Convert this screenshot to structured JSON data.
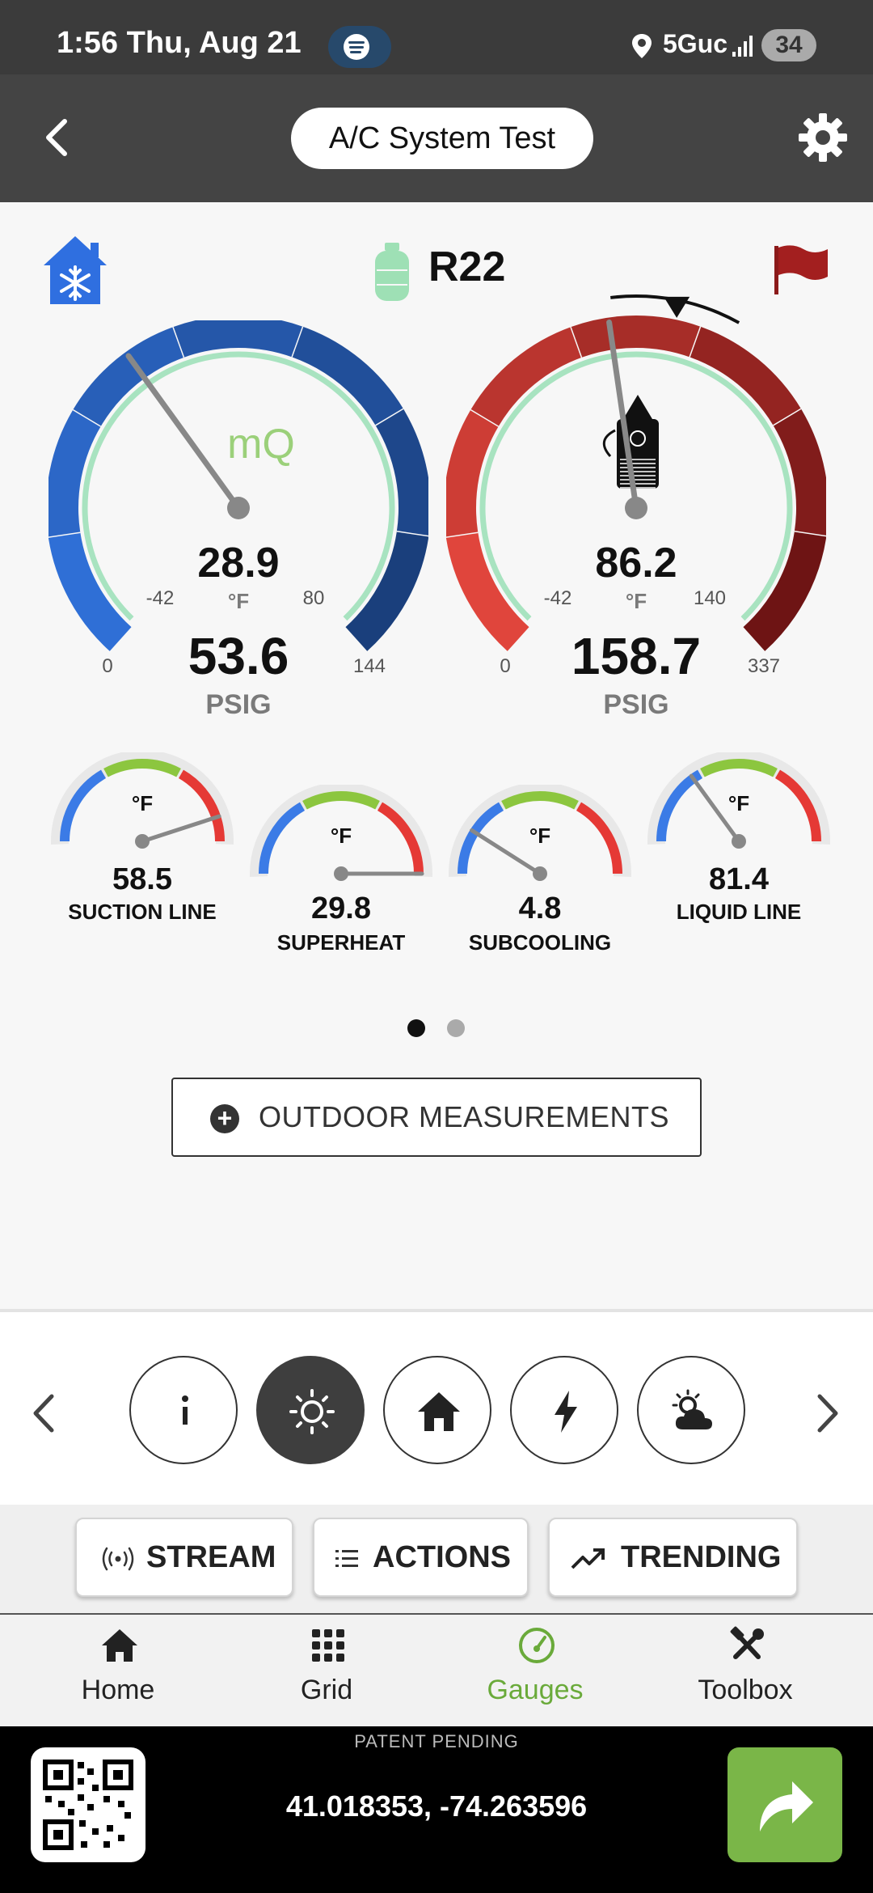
{
  "status_bar": {
    "time_date": "1:56  Thu, Aug 21",
    "network": "5Guc",
    "battery": "34",
    "icons": [
      "spotify-icon",
      "location-icon",
      "signal-icon",
      "battery-icon"
    ]
  },
  "app_bar": {
    "title": "A/C System Test",
    "icons": [
      "back-icon",
      "settings-icon"
    ]
  },
  "system": {
    "refrigerant": "R22",
    "icons": [
      "cooling-mode-icon",
      "refrigerant-tank-icon",
      "flag-icon"
    ]
  },
  "suction_gauge": {
    "temp": "28.9",
    "temp_unit": "°F",
    "temp_min": "-42",
    "temp_max": "80",
    "pressure": "53.6",
    "pressure_unit": "PSIG",
    "pressure_min": "0",
    "pressure_max": "144",
    "watermark": "mQ",
    "needle_fraction": 0.37,
    "colors": [
      "#2f6fd6",
      "#1a3f7c"
    ]
  },
  "discharge_gauge": {
    "temp": "86.2",
    "temp_unit": "°F",
    "temp_min": "-42",
    "temp_max": "140",
    "pressure": "158.7",
    "pressure_unit": "PSIG",
    "pressure_min": "0",
    "pressure_max": "337",
    "needle_fraction": 0.47,
    "target_marker_fraction": 0.54,
    "colors": [
      "#e0453c",
      "#6e1414"
    ]
  },
  "small_gauges": [
    {
      "value": "58.5",
      "unit": "°F",
      "label": "SUCTION LINE",
      "needle_fraction": 0.9
    },
    {
      "value": "29.8",
      "unit": "°F",
      "label": "SUPERHEAT",
      "needle_fraction": 1.0
    },
    {
      "value": "4.8",
      "unit": "°F",
      "label": "SUBCOOLING",
      "needle_fraction": 0.18
    },
    {
      "value": "81.4",
      "unit": "°F",
      "label": "LIQUID LINE",
      "needle_fraction": 0.3
    }
  ],
  "pager": {
    "pages": 2,
    "active": 1
  },
  "outdoor_button": {
    "label": "OUTDOOR MEASUREMENTS",
    "icon": "plus-circle-icon"
  },
  "mode_selector": {
    "items": [
      "info-icon",
      "sun-icon",
      "home-icon",
      "bolt-icon",
      "weather-icon"
    ],
    "active": 1,
    "nav_icons": [
      "chevron-left-icon",
      "chevron-right-icon"
    ]
  },
  "actions": {
    "stream": "STREAM",
    "actions": "ACTIONS",
    "trending": "TRENDING"
  },
  "tabs": {
    "home": "Home",
    "grid": "Grid",
    "gauges": "Gauges",
    "toolbox": "Toolbox",
    "active": "gauges"
  },
  "footer": {
    "patent": "PATENT PENDING",
    "coordinates": "41.018353, -74.263596",
    "icons": [
      "qr-code-icon",
      "share-icon"
    ]
  },
  "colors": {
    "accent_green": "#7ab648",
    "gauge_ring_mint": "#a8e3c0"
  }
}
